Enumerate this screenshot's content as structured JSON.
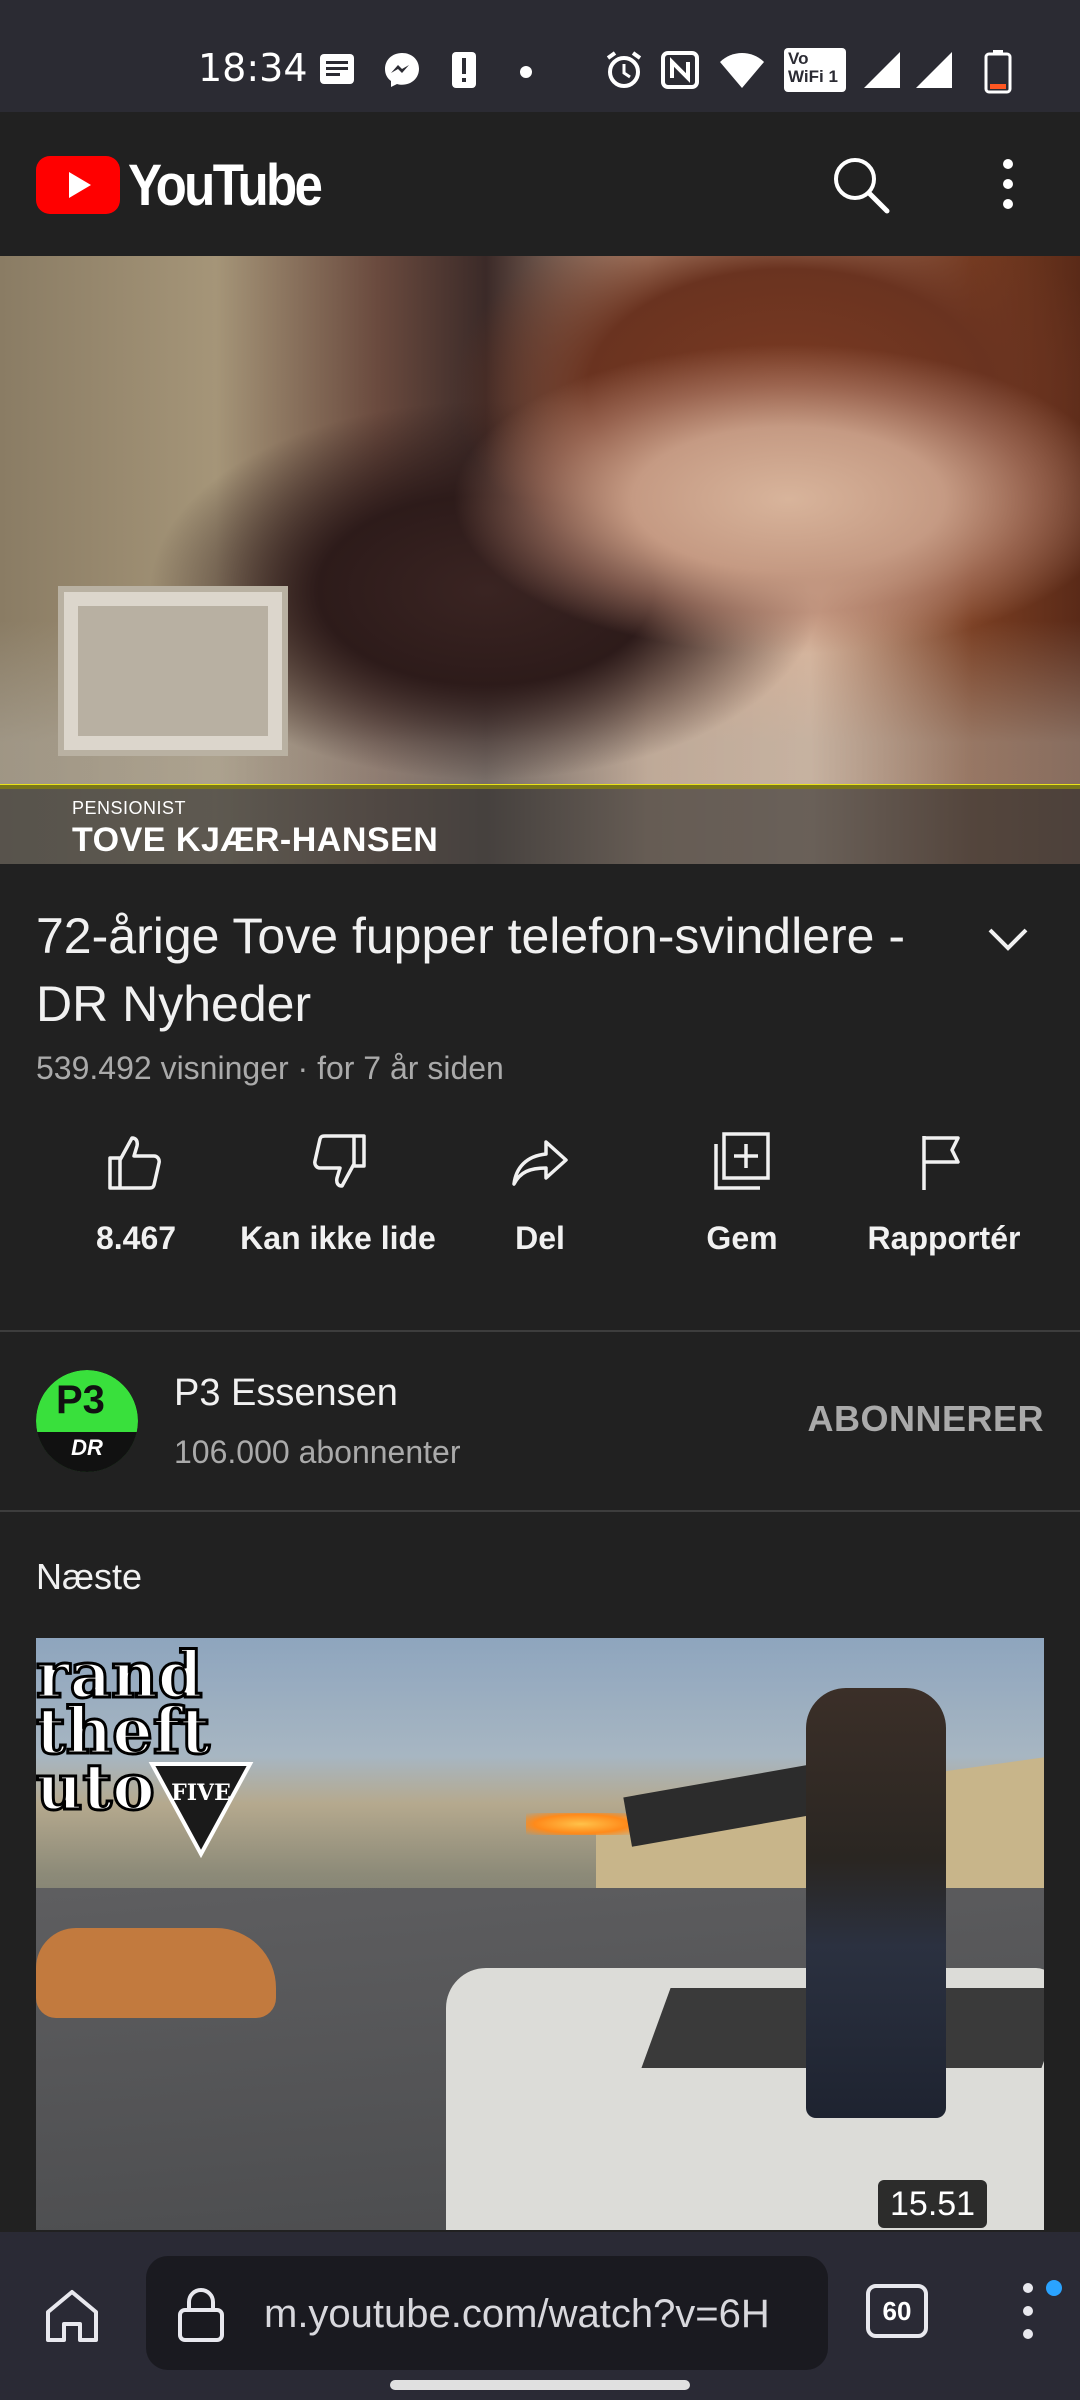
{
  "status_bar": {
    "time": "18:34",
    "wifi_call_label": "Vo WiFi 1",
    "icons": [
      "notes-icon",
      "messenger-icon",
      "alert-icon",
      "dot-icon",
      "alarm-icon",
      "nfc-icon",
      "wifi-icon",
      "vowifi-icon",
      "signal-icon",
      "signal-icon-2",
      "battery-icon"
    ]
  },
  "app_bar": {
    "brand": "YouTube",
    "search_icon": "search-icon",
    "more_icon": "more-vert-icon"
  },
  "player": {
    "lower_third_role": "PENSIONIST",
    "lower_third_name": "TOVE KJÆR-HANSEN"
  },
  "video": {
    "title": "72-årige Tove fupper telefon-svindlere - DR Nyheder",
    "meta": "539.492 visninger · for 7 år siden"
  },
  "actions": [
    {
      "label": "8.467",
      "icon": "thumbs-up-icon"
    },
    {
      "label": "Kan ikke lide",
      "icon": "thumbs-down-icon"
    },
    {
      "label": "Del",
      "icon": "share-icon"
    },
    {
      "label": "Gem",
      "icon": "add-to-playlist-icon"
    },
    {
      "label": "Rapportér",
      "icon": "flag-icon"
    }
  ],
  "channel": {
    "avatar_text_top": "P3",
    "avatar_text_bottom": "DR",
    "name": "P3 Essensen",
    "subscribers": "106.000 abonnenter",
    "subscribe_label": "ABONNERER"
  },
  "up_next": {
    "label": "Næste",
    "thumbnail_logo_text": "rand theft uto",
    "thumbnail_logo_five": "FIVE",
    "duration": "15.51"
  },
  "browser": {
    "url": "m.youtube.com/watch?v=6H",
    "tab_count": "60"
  },
  "colors": {
    "background": "#212121",
    "youtube_red": "#ff0000",
    "status_bar": "#2b2b33",
    "browser_bar": "#2a2a35",
    "lower_third_line": "#e8e21a",
    "p3_green": "#39e03c",
    "notification_dot": "#2aa3ff"
  }
}
